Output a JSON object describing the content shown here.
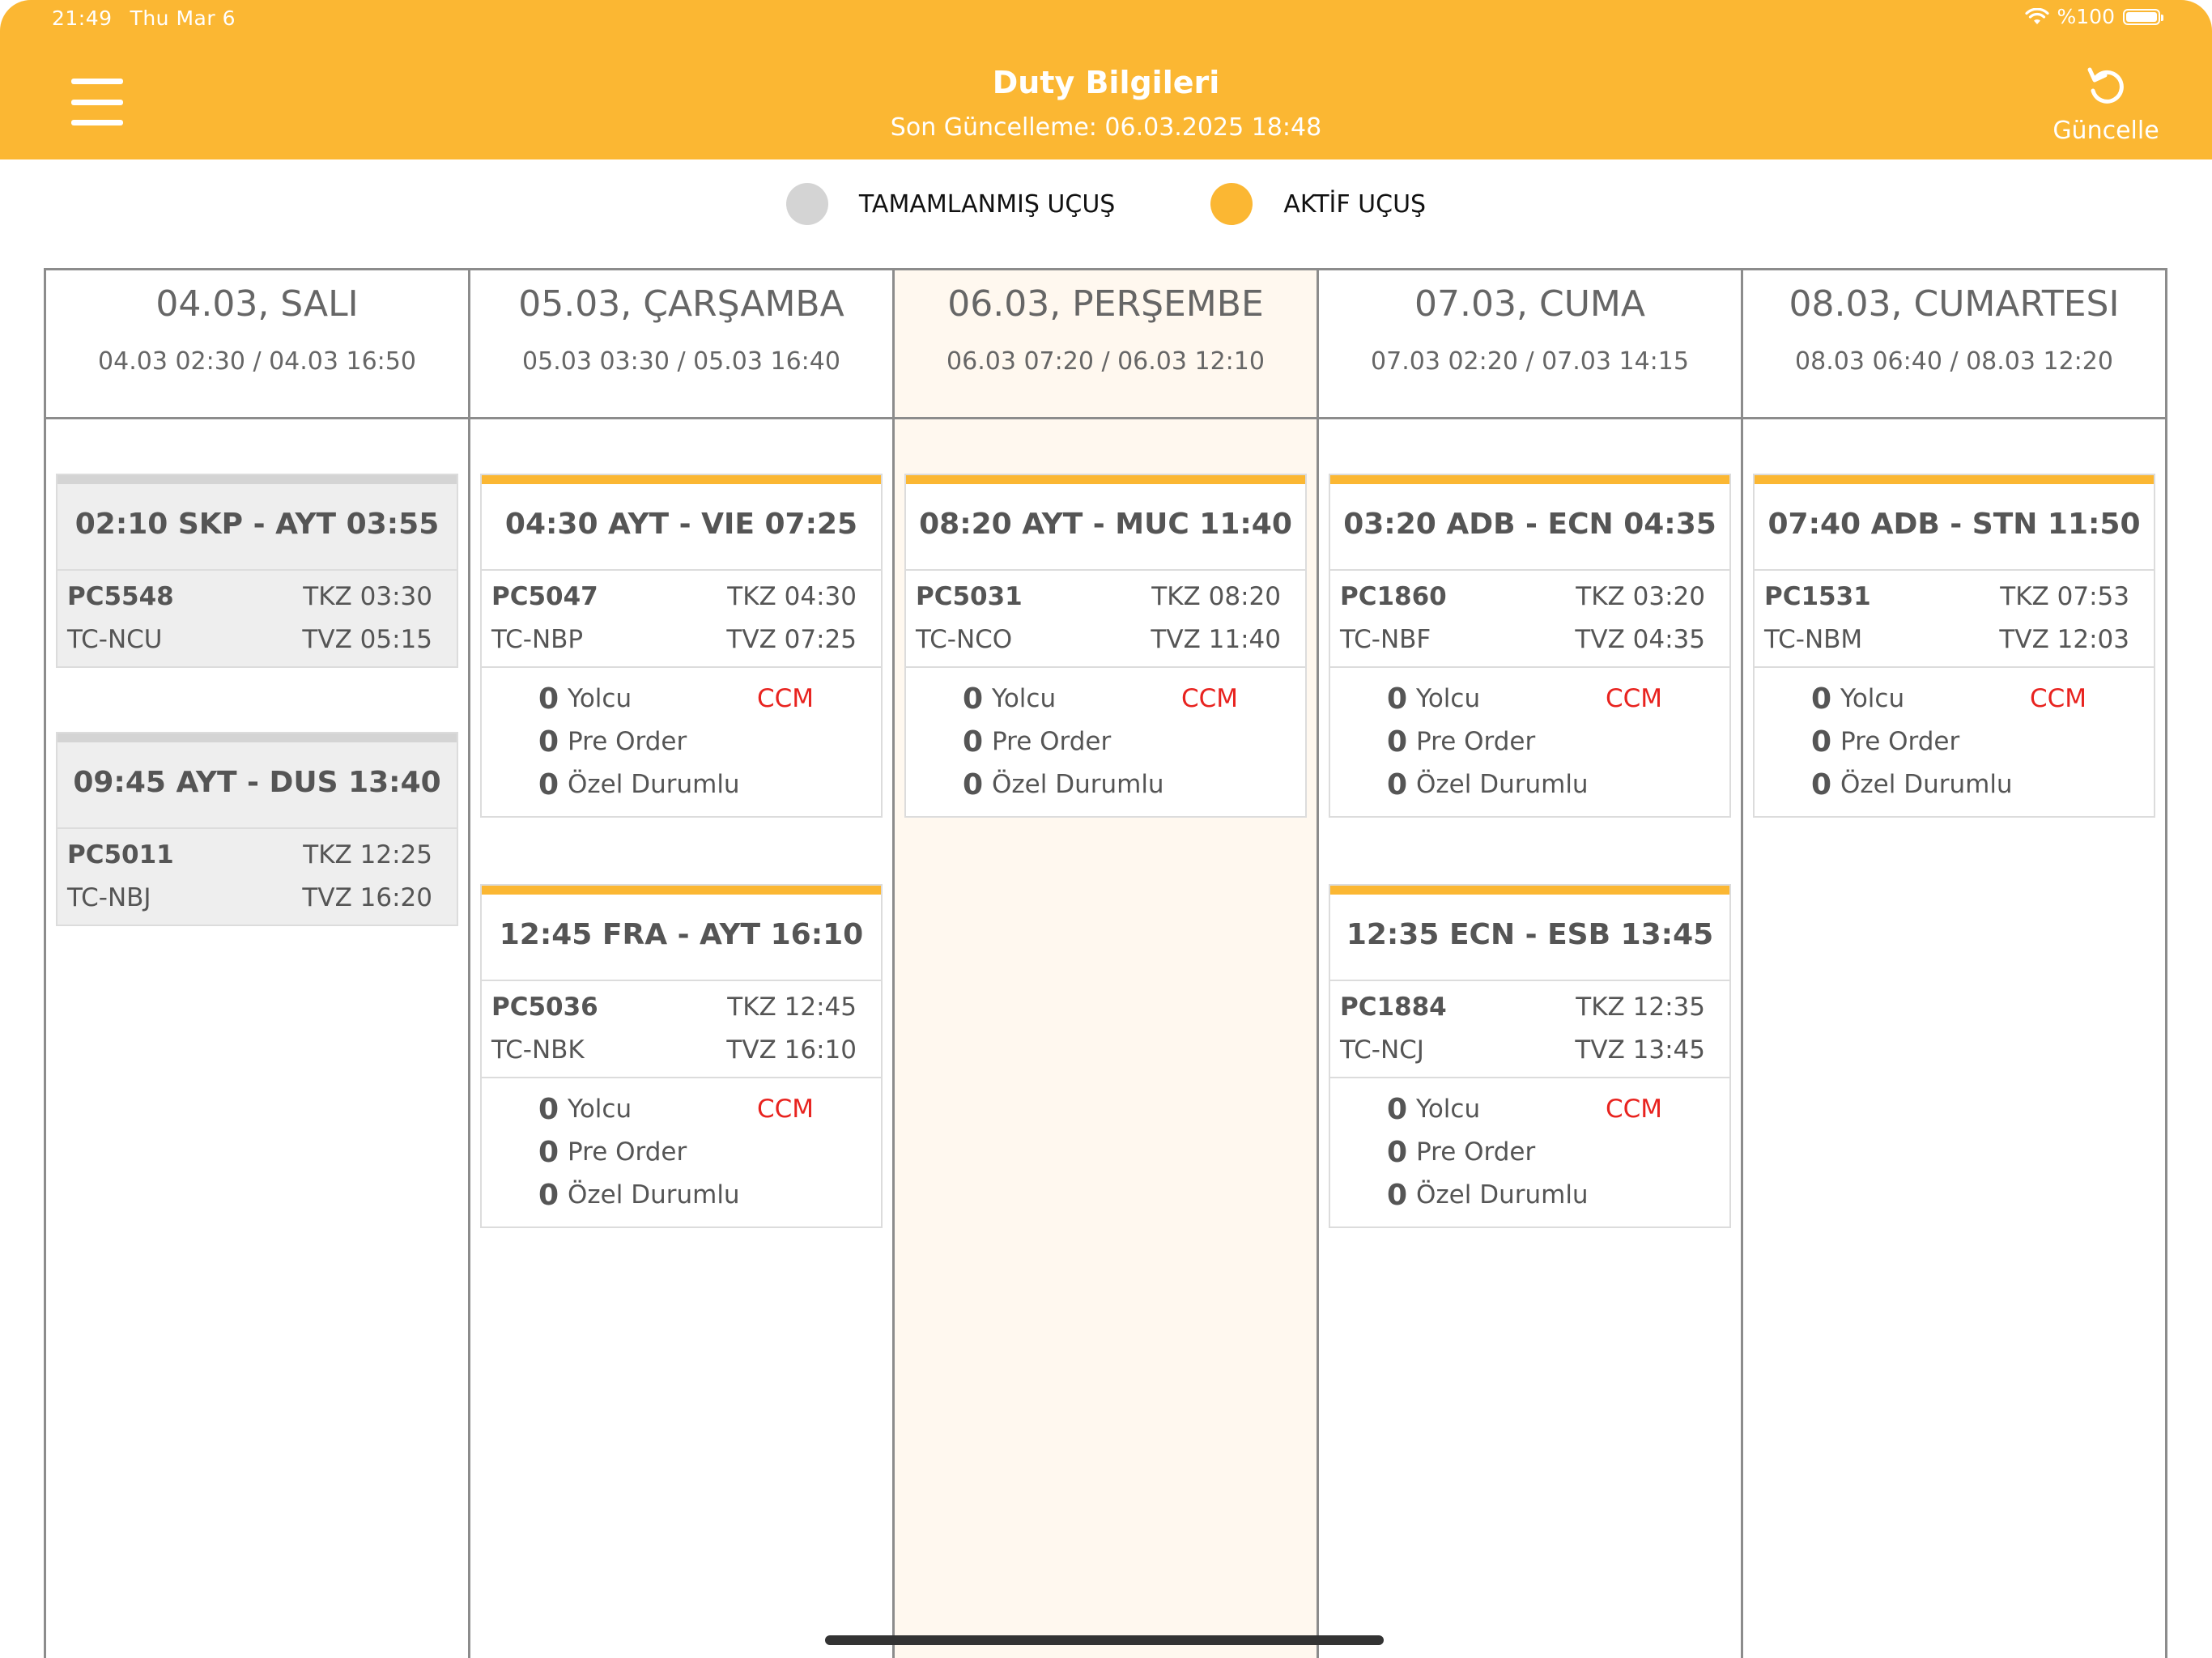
{
  "status_bar": {
    "time": "21:49",
    "date": "Thu Mar 6",
    "battery": "%100"
  },
  "header": {
    "title": "Duty Bilgileri",
    "subtitle": "Son Güncelleme: 06.03.2025 18:48",
    "refresh_label": "Güncelle"
  },
  "legend": {
    "completed": "TAMAMLANMIŞ UÇUŞ",
    "active": "AKTİF UÇUŞ"
  },
  "colors": {
    "accent": "#FBB733",
    "completed": "#d4d4d4",
    "ccm": "#e8231f"
  },
  "days": [
    {
      "title": "04.03, SALI",
      "range": "04.03 02:30 / 04.03 16:50",
      "flights": [
        {
          "route": "02:10 SKP - AYT 03:55",
          "flight_no": "PC5548",
          "tkz": "TKZ 03:30",
          "reg": "TC-NCU",
          "tvz": "TVZ 05:15"
        },
        {
          "route": "09:45 AYT - DUS 13:40",
          "flight_no": "PC5011",
          "tkz": "TKZ 12:25",
          "reg": "TC-NBJ",
          "tvz": "TVZ 16:20"
        }
      ]
    },
    {
      "title": "05.03, ÇARŞAMBA",
      "range": "05.03 03:30 / 05.03 16:40",
      "flights": [
        {
          "route": "04:30 AYT - VIE 07:25",
          "flight_no": "PC5047",
          "tkz": "TKZ 04:30",
          "reg": "TC-NBP",
          "tvz": "TVZ 07:25",
          "pax": "0",
          "pax_label": "Yolcu",
          "ccm": "CCM",
          "pre_order": "0",
          "pre_order_label": "Pre Order",
          "special": "0",
          "special_label": "Özel Durumlu"
        },
        {
          "route": "12:45 FRA - AYT 16:10",
          "flight_no": "PC5036",
          "tkz": "TKZ 12:45",
          "reg": "TC-NBK",
          "tvz": "TVZ 16:10",
          "pax": "0",
          "pax_label": "Yolcu",
          "ccm": "CCM",
          "pre_order": "0",
          "pre_order_label": "Pre Order",
          "special": "0",
          "special_label": "Özel Durumlu"
        }
      ]
    },
    {
      "title": "06.03, PERŞEMBE",
      "range": "06.03 07:20 / 06.03 12:10",
      "flights": [
        {
          "route": "08:20 AYT - MUC 11:40",
          "flight_no": "PC5031",
          "tkz": "TKZ 08:20",
          "reg": "TC-NCO",
          "tvz": "TVZ 11:40",
          "pax": "0",
          "pax_label": "Yolcu",
          "ccm": "CCM",
          "pre_order": "0",
          "pre_order_label": "Pre Order",
          "special": "0",
          "special_label": "Özel Durumlu"
        }
      ]
    },
    {
      "title": "07.03, CUMA",
      "range": "07.03 02:20 / 07.03 14:15",
      "flights": [
        {
          "route": "03:20 ADB - ECN 04:35",
          "flight_no": "PC1860",
          "tkz": "TKZ 03:20",
          "reg": "TC-NBF",
          "tvz": "TVZ 04:35",
          "pax": "0",
          "pax_label": "Yolcu",
          "ccm": "CCM",
          "pre_order": "0",
          "pre_order_label": "Pre Order",
          "special": "0",
          "special_label": "Özel Durumlu"
        },
        {
          "route": "12:35 ECN - ESB 13:45",
          "flight_no": "PC1884",
          "tkz": "TKZ 12:35",
          "reg": "TC-NCJ",
          "tvz": "TVZ 13:45",
          "pax": "0",
          "pax_label": "Yolcu",
          "ccm": "CCM",
          "pre_order": "0",
          "pre_order_label": "Pre Order",
          "special": "0",
          "special_label": "Özel Durumlu"
        }
      ]
    },
    {
      "title": "08.03, CUMARTESI",
      "range": "08.03 06:40 / 08.03 12:20",
      "flights": [
        {
          "route": "07:40 ADB - STN 11:50",
          "flight_no": "PC1531",
          "tkz": "TKZ 07:53",
          "reg": "TC-NBM",
          "tvz": "TVZ 12:03",
          "pax": "0",
          "pax_label": "Yolcu",
          "ccm": "CCM",
          "pre_order": "0",
          "pre_order_label": "Pre Order",
          "special": "0",
          "special_label": "Özel Durumlu"
        }
      ]
    }
  ]
}
